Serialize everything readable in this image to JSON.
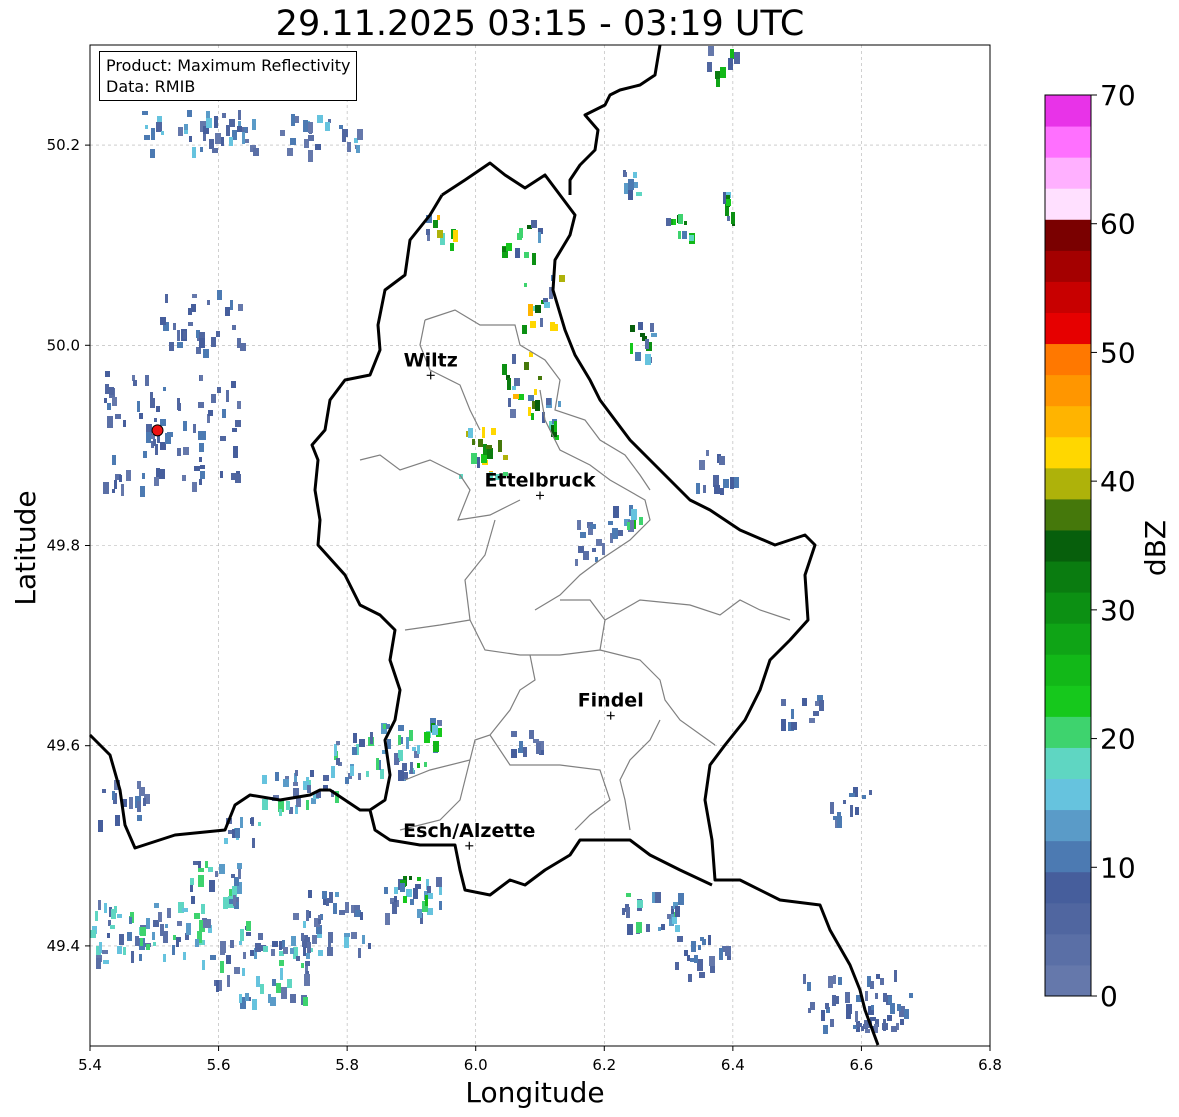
{
  "title": "29.11.2025 03:15 - 03:19 UTC",
  "info": {
    "product": "Product: Maximum Reflectivity",
    "data": "Data: RMIB"
  },
  "axes": {
    "xlabel": "Longitude",
    "ylabel": "Latitude",
    "xlim": [
      5.4,
      6.8
    ],
    "ylim": [
      49.3,
      50.3
    ],
    "xticks": [
      "5.4",
      "5.6",
      "5.8",
      "6.0",
      "6.2",
      "6.4",
      "6.6",
      "6.8"
    ],
    "yticks": [
      "49.4",
      "49.6",
      "49.8",
      "50.0",
      "50.2"
    ],
    "grid": true
  },
  "colorbar": {
    "label": "dBZ",
    "ticks": [
      "0",
      "10",
      "20",
      "30",
      "40",
      "50",
      "60",
      "70"
    ],
    "range": [
      0,
      70
    ],
    "colors": [
      "#6578ab",
      "#5a6fa6",
      "#5066a0",
      "#465e9c",
      "#4c7ab2",
      "#5a9bc8",
      "#66c3de",
      "#5fd6c2",
      "#3ed36e",
      "#16c81c",
      "#12b818",
      "#0fa416",
      "#0c9013",
      "#0a7c10",
      "#075f0c",
      "#45780b",
      "#aeb20a",
      "#ffd700",
      "#ffb400",
      "#ff9600",
      "#ff7800",
      "#e60000",
      "#c80000",
      "#a40000",
      "#7a0000",
      "#ffe0ff",
      "#ffb0ff",
      "#ff70ff",
      "#e833e8"
    ]
  },
  "cities": [
    {
      "name": "Wiltz",
      "lon": 5.93,
      "lat": 49.97
    },
    {
      "name": "Ettelbruck",
      "lon": 6.1,
      "lat": 49.85
    },
    {
      "name": "Findel",
      "lon": 6.21,
      "lat": 49.63
    },
    {
      "name": "Esch/Alzette",
      "lon": 5.99,
      "lat": 49.5
    }
  ],
  "radar_site": {
    "lon": 5.505,
    "lat": 49.915
  },
  "colors": {
    "border": "#000000",
    "cantons": "#808080",
    "grid": "#b0b0b0",
    "radar_marker": "#ee1111"
  }
}
